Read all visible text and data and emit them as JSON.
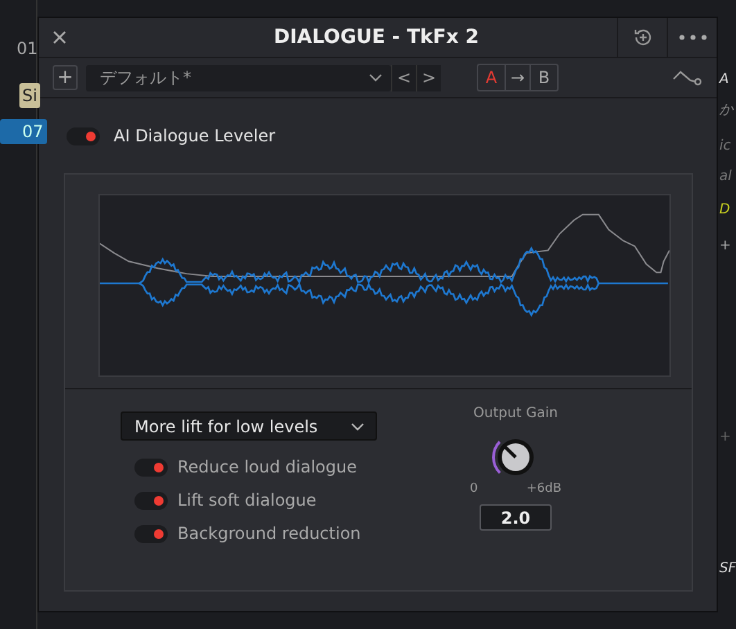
{
  "background": {
    "left_labels": [
      "01",
      "Si",
      "07"
    ],
    "right_labels": [
      "A",
      "か",
      "ic",
      "al",
      "D",
      "+",
      "+",
      "SF"
    ]
  },
  "window": {
    "title": "DIALOGUE - TkFx 2"
  },
  "toolbar": {
    "add": "+",
    "preset": "デフォルト*",
    "prev": "<",
    "next": ">",
    "copy_arrow": "→",
    "compare": [
      {
        "label": "A",
        "selected": true
      },
      {
        "label": "B",
        "selected": false
      }
    ]
  },
  "leveler": {
    "label": "AI Dialogue Leveler",
    "on": true
  },
  "mode": {
    "value": "More lift for low levels"
  },
  "options": [
    {
      "label": "Reduce loud dialogue",
      "on": true
    },
    {
      "label": "Lift soft dialogue",
      "on": true
    },
    {
      "label": "Background reduction",
      "on": true
    }
  ],
  "output_gain": {
    "label": "Output Gain",
    "min_label": "0",
    "max_label": "+6dB",
    "value": "2.0"
  }
}
